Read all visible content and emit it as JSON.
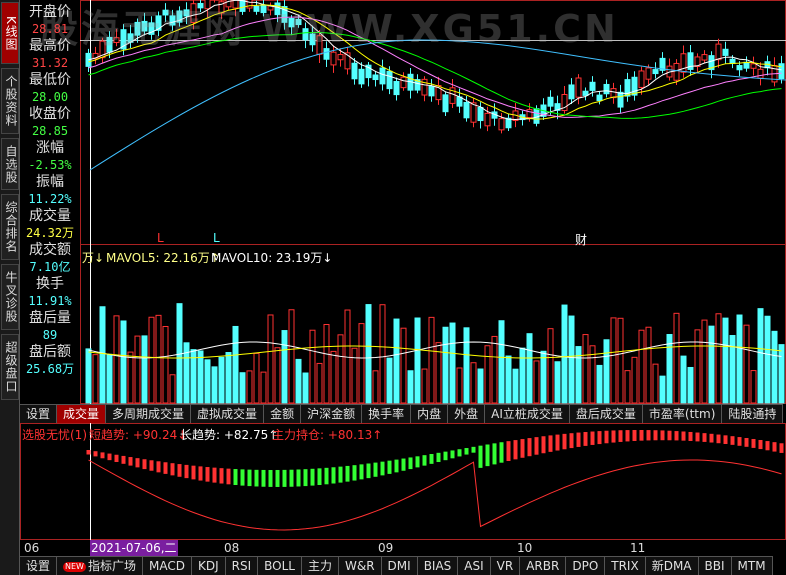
{
  "left_tabs": [
    {
      "label": "K线图",
      "active": true
    },
    {
      "label": "个股资料",
      "active": false
    },
    {
      "label": "自选股",
      "active": false
    },
    {
      "label": "综合排名",
      "active": false
    },
    {
      "label": "牛叉诊股",
      "active": false
    },
    {
      "label": "超级盘口",
      "active": false
    }
  ],
  "info": {
    "open_label": "开盘价",
    "open_value": "28.81",
    "high_label": "最高价",
    "high_value": "31.32",
    "low_label": "最低价",
    "low_value": "28.00",
    "close_label": "收盘价",
    "close_value": "28.85",
    "change_label": "涨幅",
    "change_value": "-2.53%",
    "amplitude_label": "振幅",
    "amplitude_value": "11.22%",
    "volume_label": "成交量",
    "volume_value": "24.32万",
    "amount_label": "成交额",
    "amount_value": "7.10亿",
    "turnover_label": "换手",
    "turnover_value": "11.91%",
    "after_volume_label": "盘后量",
    "after_volume_value": "89",
    "after_amount_label": "盘后额",
    "after_amount_value": "25.68万"
  },
  "watermark": "股海无涯网 WWW.XG51.CN",
  "markers": [
    "L",
    "L",
    "财"
  ],
  "volume_legend": {
    "prefix": "万↓",
    "mavol5": "MAVOL5: 22.16万↑",
    "mavol10": "MAVOL10: 23.19万↓"
  },
  "volume_tabs": [
    "设置",
    "成交量",
    "多周期成交量",
    "虚拟成交量",
    "金额",
    "沪深金额",
    "换手率",
    "内盘",
    "外盘",
    "AI立桩成交量",
    "盘后成交量",
    "市盈率(ttm)",
    "陆股通持"
  ],
  "volume_tab_active": 1,
  "indicator_legend": {
    "name": "选股无忧(1)",
    "short_trend": "短趋势: +90.24↓",
    "long_trend": "长趋势: +82.75↑",
    "main_holding": "主力持仓: +80.13↑"
  },
  "dates": [
    "06",
    "2021-07-06,二",
    "08",
    "09",
    "10",
    "11"
  ],
  "bottom_tabs": [
    "设置",
    "指标广场",
    "MACD",
    "KDJ",
    "RSI",
    "BOLL",
    "主力",
    "W&R",
    "DMI",
    "BIAS",
    "ASI",
    "VR",
    "ARBR",
    "DPO",
    "TRIX",
    "新DMA",
    "BBI",
    "MTM"
  ],
  "bottom_new_badge": "NEW",
  "colors": {
    "up": "#ff3232",
    "down": "#54ffff",
    "ma5": "#ffffff",
    "ma10": "#ffff00",
    "ma20": "#ff80ff",
    "ma30": "#00ff00",
    "ma60": "#40c0ff",
    "panel_border": "#aa2222",
    "indicator_green": "#33ff33"
  }
}
